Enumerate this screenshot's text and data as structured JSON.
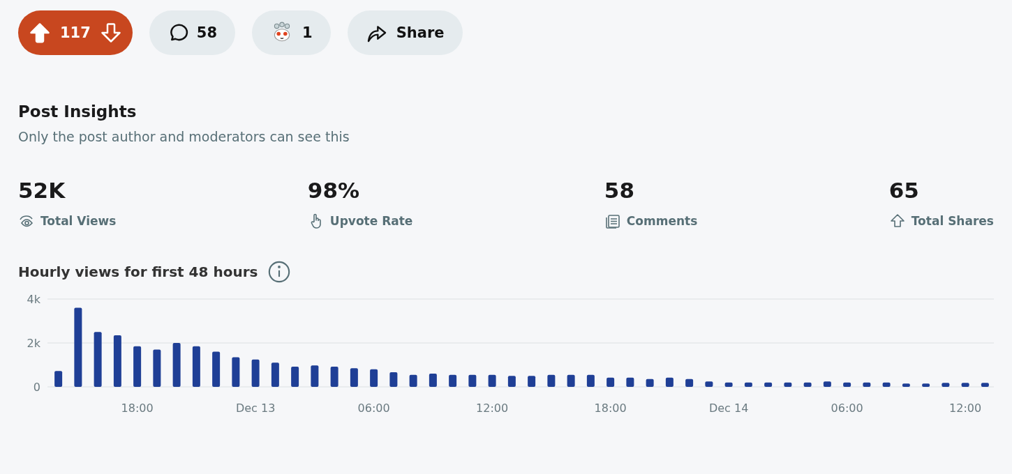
{
  "actions": {
    "vote": {
      "score": "117",
      "upvoted": true
    },
    "comments": "58",
    "awards": "1",
    "share": "Share"
  },
  "insights": {
    "title": "Post Insights",
    "subtitle": "Only the post author and moderators can see this",
    "stats": [
      {
        "kind": "views",
        "value": "52K",
        "label": "Total Views"
      },
      {
        "kind": "upvote",
        "value": "98%",
        "label": "Upvote Rate"
      },
      {
        "kind": "comments",
        "value": "58",
        "label": "Comments"
      },
      {
        "kind": "shares",
        "value": "65",
        "label": "Total Shares"
      }
    ],
    "chart_title": "Hourly views for first 48 hours",
    "chart_data": {
      "type": "bar",
      "categories": [
        null,
        null,
        null,
        null,
        "18:00",
        null,
        null,
        null,
        null,
        null,
        "Dec 13",
        null,
        null,
        null,
        null,
        null,
        "06:00",
        null,
        null,
        null,
        null,
        null,
        "12:00",
        null,
        null,
        null,
        null,
        null,
        "18:00",
        null,
        null,
        null,
        null,
        null,
        "Dec 14",
        null,
        null,
        null,
        null,
        null,
        "06:00",
        null,
        null,
        null,
        null,
        null,
        "12:00",
        null
      ],
      "series": [
        {
          "color": "#1f3f96",
          "values": [
            720,
            3600,
            2500,
            2350,
            1850,
            1700,
            2000,
            1850,
            1600,
            1350,
            1250,
            1100,
            920,
            980,
            920,
            850,
            800,
            670,
            550,
            600,
            550,
            550,
            550,
            500,
            500,
            550,
            550,
            550,
            420,
            420,
            360,
            420,
            360,
            250,
            200,
            200,
            200,
            200,
            200,
            250,
            200,
            200,
            200,
            150,
            150,
            180,
            180,
            180
          ]
        }
      ],
      "ylim": [
        0,
        4000
      ],
      "yticks": [
        {
          "value": 0,
          "label": "0"
        },
        {
          "value": 2000,
          "label": "2k"
        },
        {
          "value": 4000,
          "label": "4k"
        }
      ]
    }
  }
}
